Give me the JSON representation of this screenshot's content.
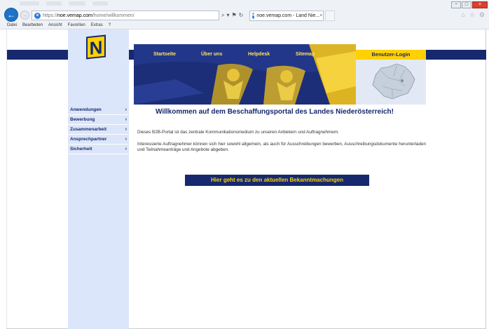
{
  "browser": {
    "ghost_tabs": [
      "",
      "",
      "",
      ""
    ],
    "back_icon": "back-arrow-icon",
    "url_prefix": "https://",
    "url_domain": "noe.vemap.com",
    "url_path": "/home/willkommen/",
    "address_icons": "⌕ ▾ 🔒 C",
    "tab_title": "noe.vemap.com - Land Nie...",
    "tab_close": "×",
    "menu": [
      "Datei",
      "Bearbeiten",
      "Ansicht",
      "Favoriten",
      "Extras",
      "?"
    ],
    "window_controls": {
      "minimize": "−",
      "maximize": "□",
      "close": "×"
    }
  },
  "site": {
    "logo_letter": "N",
    "colors": {
      "brand_blue": "#16296e",
      "brand_yellow": "#ffd100",
      "sidebar_bg": "#dce6fa"
    },
    "top_nav": [
      "Startseite",
      "Über uns",
      "Helpdesk",
      "Sitemap"
    ],
    "login_label": "Benutzer-Login",
    "side_nav": [
      "Anwendungen",
      "Bewerbung",
      "Zusammenarbeit",
      "Ansprechpartner",
      "Sicherheit"
    ],
    "side_chevron": "›",
    "headline": "Willkommen auf dem Beschaffungsportal des Landes Niederösterreich!",
    "paragraph1": "Dieses B2B-Portal ist das zentrale Kommunikationsmedium zu unseren Anbietern und Auftragnehmern.",
    "paragraph2": "Interessierte Auftragnehmer können sich hier sowohl allgemein, als auch für Ausschreibungen bewerben, Ausschreibungsdokumente herunterladen und Teilnahmeanträge und Angebote abgeben.",
    "announce_button": "Hier geht es zu den aktuellen Bekanntmachungen"
  }
}
